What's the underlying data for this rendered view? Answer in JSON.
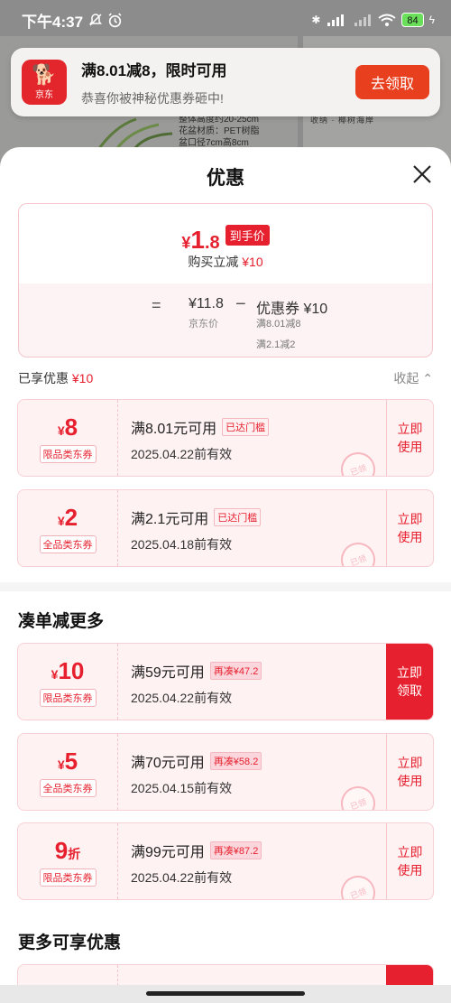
{
  "status_bar": {
    "time": "下午4:37",
    "battery": "84"
  },
  "background": {
    "spec_lines": [
      "整体高度约20-25cm",
      "花盆材质：PET树脂",
      "盆口径7cm高8cm"
    ],
    "right_caption": "收纳 · 椰树海岸"
  },
  "notification": {
    "app_logo_text": "京东",
    "title": "满8.01减8，限时可用",
    "subtitle": "恭喜你被神秘优惠券砸中!",
    "button": "去领取"
  },
  "sheet": {
    "title": "优惠",
    "summary": {
      "yen": "¥",
      "price_int": "1",
      "price_dec": ".8",
      "price_tag": "到手价",
      "buy_reduce_label": "购买立减",
      "buy_reduce_value": "¥10",
      "eq": "=",
      "jd_price": "¥11.8",
      "jd_price_label": "京东价",
      "minus": "−",
      "coupon_total": "优惠券 ¥10",
      "coupon_line1": "满8.01减8",
      "coupon_line2": "满2.1减2"
    },
    "enjoyed": {
      "label": "已享优惠",
      "value": "¥10",
      "collapse": "收起"
    },
    "applied_coupons": [
      {
        "value": "8",
        "type": "限品类东券",
        "condition": "满8.01元可用",
        "badge": "已达门槛",
        "date": "2025.04.22前有效",
        "action": "立即\n使用",
        "stamp": "已领"
      },
      {
        "value": "2",
        "type": "全品类东券",
        "condition": "满2.1元可用",
        "badge": "已达门槛",
        "date": "2025.04.18前有效",
        "action": "立即\n使用",
        "stamp": "已领"
      }
    ],
    "more_section_title": "凑单减更多",
    "more_coupons": [
      {
        "value": "10",
        "unit": "¥",
        "type": "限品类东券",
        "condition": "满59元可用",
        "badge": "再凑¥47.2",
        "date": "2025.04.22前有效",
        "action": "立即\n领取",
        "filled": true
      },
      {
        "value": "5",
        "unit": "¥",
        "type": "全品类东券",
        "condition": "满70元可用",
        "badge": "再凑¥58.2",
        "date": "2025.04.15前有效",
        "action": "立即\n使用",
        "stamp": "已领"
      },
      {
        "value": "9",
        "unit": "折",
        "type": "限品类东券",
        "condition": "满99元可用",
        "badge": "再凑¥87.2",
        "date": "2025.04.22前有效",
        "action": "立即\n使用",
        "stamp": "已领"
      }
    ],
    "extra_section_title": "更多可享优惠"
  },
  "colors": {
    "brand_red": "#e6202e",
    "notif_button": "#e8401f"
  }
}
